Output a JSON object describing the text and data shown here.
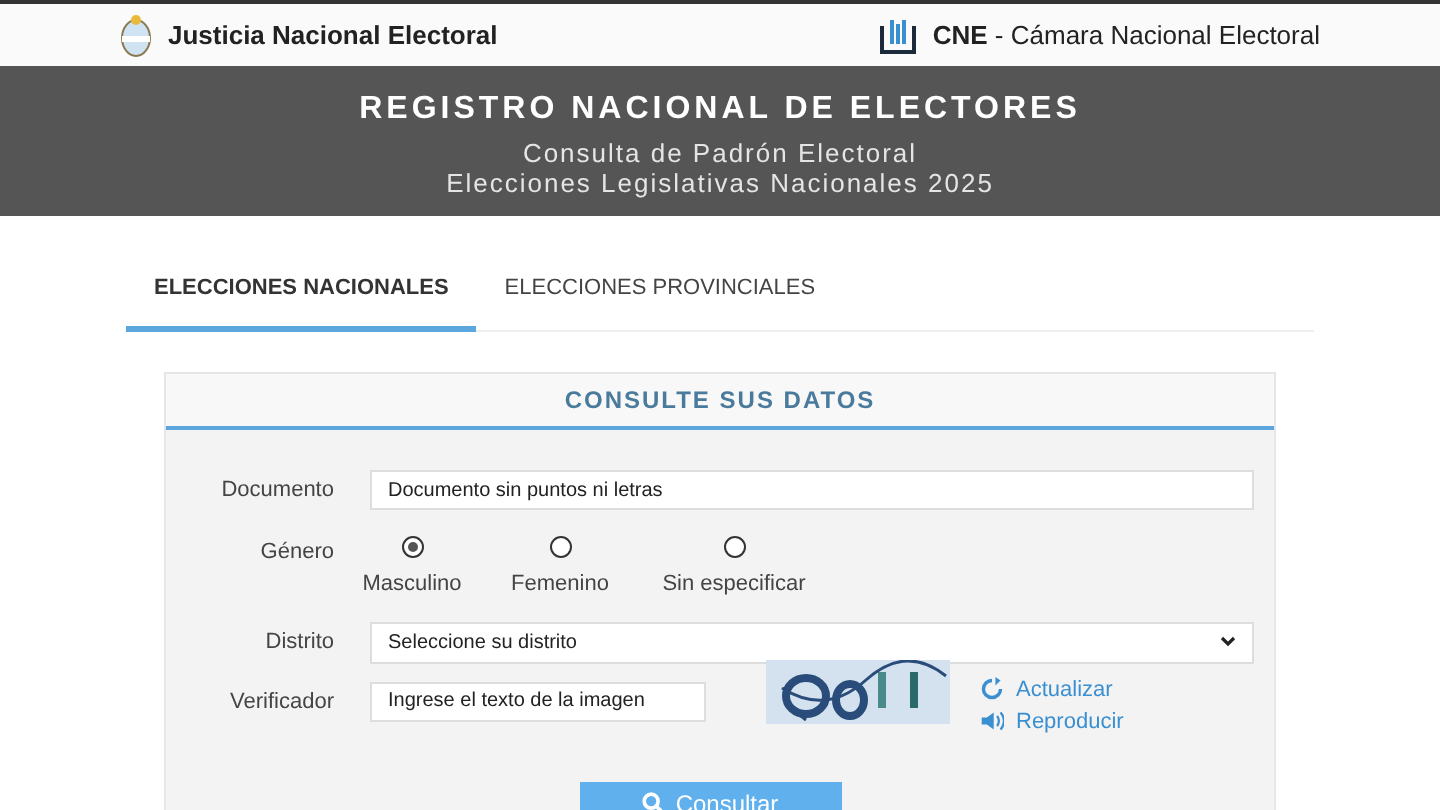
{
  "top_bar": {
    "left_title": "Justicia Nacional Electoral",
    "right_brand": "CNE",
    "right_title": " - Cámara Nacional Electoral"
  },
  "banner": {
    "title": "REGISTRO NACIONAL DE ELECTORES",
    "subtitle": "Consulta de Padrón Electoral",
    "subtitle_2": "Elecciones Legislativas Nacionales 2025"
  },
  "tabs": [
    {
      "label": "ELECCIONES NACIONALES",
      "selected": true
    },
    {
      "label": "ELECCIONES PROVINCIALES",
      "selected": false
    }
  ],
  "form": {
    "heading": "CONSULTE SUS DATOS",
    "document": {
      "label": "Documento",
      "placeholder": "Documento sin puntos ni letras"
    },
    "gender": {
      "label": "Género",
      "options": [
        {
          "label": "Masculino",
          "selected": true
        },
        {
          "label": "Femenino",
          "selected": false
        },
        {
          "label": "Sin especificar",
          "selected": false
        }
      ]
    },
    "district": {
      "label": "Distrito",
      "value": "Seleccione su distrito"
    },
    "verifier": {
      "label": "Verificador",
      "placeholder": "Ingrese el texto de la imagen",
      "refresh_link": "Actualizar",
      "play_link": "Reproducir"
    },
    "submit": "Consultar"
  }
}
